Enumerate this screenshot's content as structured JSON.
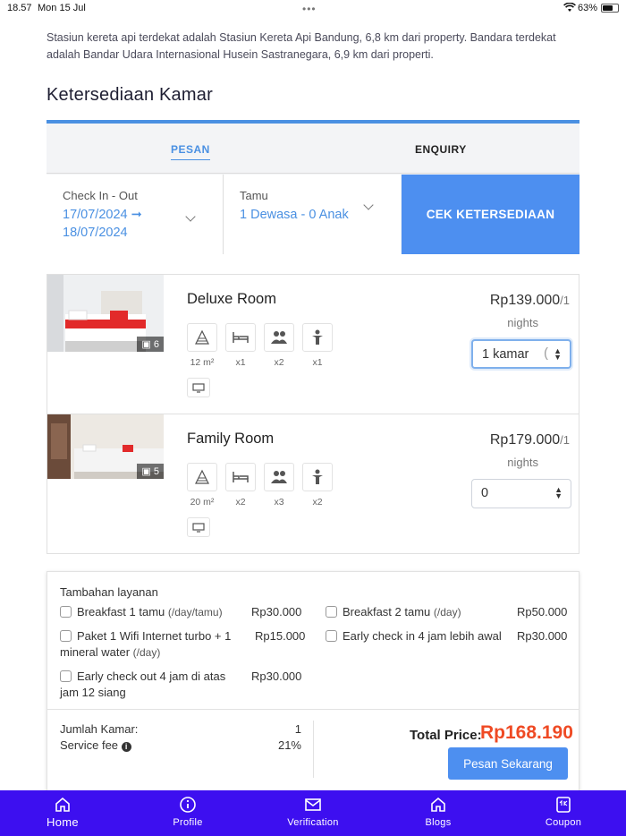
{
  "status_bar": {
    "time": "18.57",
    "date": "Mon 15 Jul",
    "dots": "•••",
    "battery": "63%"
  },
  "description": "Stasiun kereta api terdekat adalah Stasiun Kereta Api Bandung, 6,8 km dari property. Bandara terdekat adalah Bandar Udara Internasional Husein Sastranegara, 6,9 km dari properti.",
  "section_title": "Ketersediaan Kamar",
  "booking": {
    "tabs": [
      "PESAN",
      "ENQUIRY"
    ],
    "active_tab": "PESAN",
    "checkin_label": "Check In - Out",
    "checkin_value": "17/07/2024 ➞ 18/07/2024",
    "guest_label": "Tamu",
    "guest_value": "1 Dewasa - 0 Anak",
    "check_button": "CEK KETERSEDIAAN",
    "accent_color": "#4d8ff0"
  },
  "rooms": [
    {
      "name": "Deluxe Room",
      "photo_count": "6",
      "amenities": [
        {
          "icon": "area-icon",
          "label": "12 m²"
        },
        {
          "icon": "bed-icon",
          "label": "x1"
        },
        {
          "icon": "adults-icon",
          "label": "x2"
        },
        {
          "icon": "child-icon",
          "label": "x1"
        }
      ],
      "price": "Rp139.000",
      "price_unit": "/1",
      "nights": "nights",
      "select_value": "1 kamar",
      "select_trail": "("
    },
    {
      "name": "Family Room",
      "photo_count": "5",
      "amenities": [
        {
          "icon": "area-icon",
          "label": "20 m²"
        },
        {
          "icon": "bed-icon",
          "label": "x2"
        },
        {
          "icon": "adults-icon",
          "label": "x3"
        },
        {
          "icon": "child-icon",
          "label": "x2"
        }
      ],
      "price": "Rp179.000",
      "price_unit": "/1",
      "nights": "nights",
      "select_value": "0",
      "select_trail": ""
    }
  ],
  "services": {
    "title": "Tambahan layanan",
    "items": [
      {
        "label": "Breakfast 1 tamu",
        "sub": "(/day/tamu)",
        "price": "Rp30.000"
      },
      {
        "label": "Breakfast 2 tamu",
        "sub": "(/day)",
        "price": "Rp50.000"
      },
      {
        "label": "Paket 1 Wifi Internet turbo + 1 mineral water",
        "sub": "(/day)",
        "price": "Rp15.000"
      },
      {
        "label": "Early check in 4 jam lebih awal",
        "sub": "",
        "price": "Rp30.000"
      },
      {
        "label": "Early check out 4 jam di atas jam 12 siang",
        "sub": "",
        "price": "Rp30.000"
      }
    ]
  },
  "summary": {
    "rooms_label": "Jumlah Kamar:",
    "rooms_value": "1",
    "fee_label": "Service fee",
    "fee_value": "21%",
    "total_label": "Total Price:",
    "total_value": "Rp168.190",
    "total_color": "#ef4a24",
    "book_button": "Pesan Sekarang"
  },
  "nav": {
    "color": "#3d0ff0",
    "items": [
      {
        "label": "Home",
        "icon": "home-icon"
      },
      {
        "label": "Profile",
        "icon": "info-circle-icon"
      },
      {
        "label": "Verification",
        "icon": "envelope-icon"
      },
      {
        "label": "Blogs",
        "icon": "home-icon"
      },
      {
        "label": "Coupon",
        "icon": "coupon-icon"
      }
    ]
  }
}
